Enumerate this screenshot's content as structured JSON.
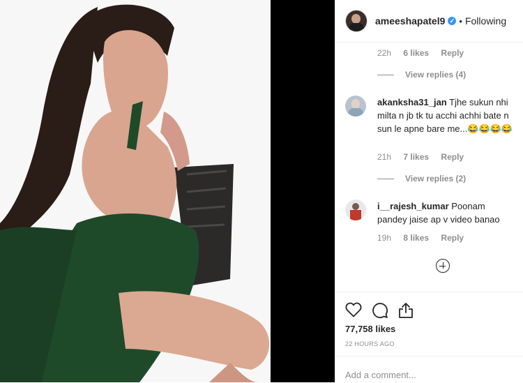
{
  "post": {
    "username": "ameeshapatel9",
    "dot": "•",
    "follow_status": "Following"
  },
  "comments": [
    {
      "time": "22h",
      "likes": "6 likes",
      "reply": "Reply",
      "view_replies": "View replies (4)"
    },
    {
      "user": "akanksha31_jan",
      "text": "Tjhe sukun nhi milta n jb tk tu acchi achhi bate n sun le apne bare me...😂😂😂😂",
      "time": "21h",
      "likes": "7 likes",
      "reply": "Reply",
      "view_replies": "View replies (2)"
    },
    {
      "user": "i__rajesh_kumar",
      "text": "Poonam pandey jaise ap v video banao",
      "time": "19h",
      "likes": "8 likes",
      "reply": "Reply"
    }
  ],
  "footer": {
    "likes_count": "77,758 likes",
    "posted_ago": "22 HOURS AGO",
    "comment_placeholder": "Add a comment..."
  },
  "icons": {
    "verified": "verified-badge-icon",
    "like": "heart-icon",
    "comment": "comment-bubble-icon",
    "share": "share-icon",
    "more": "plus-circle-icon"
  },
  "colors": {
    "verified": "#3897f0",
    "secondary_text": "#8e8e8e",
    "dress": "#1f4a2a"
  }
}
